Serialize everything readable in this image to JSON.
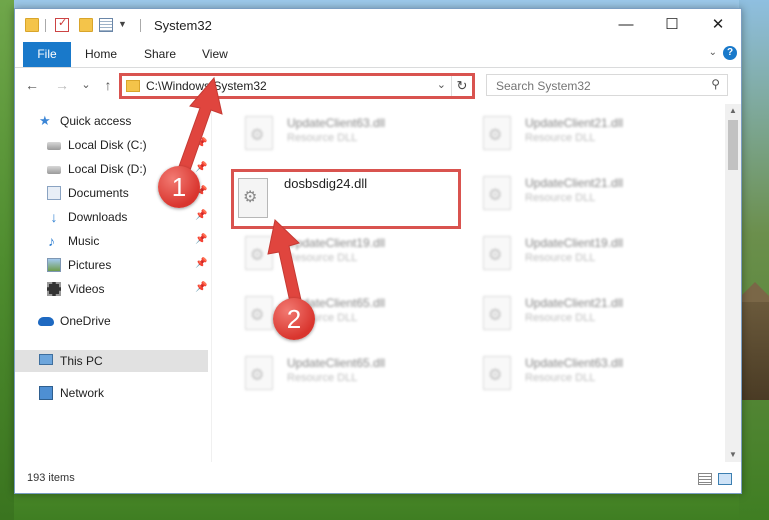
{
  "window": {
    "title": "System32"
  },
  "titlebar": {
    "minimize": "—",
    "maximize": "☐",
    "close": "✕"
  },
  "ribbon": {
    "tabs": [
      "File",
      "Home",
      "Share",
      "View"
    ],
    "help": "?"
  },
  "navigation": {
    "back": "←",
    "forward": "→",
    "recent": "⌄",
    "up": "↑",
    "address": "C:\\Windows\\System32",
    "refresh": "↻",
    "search_placeholder": "Search System32"
  },
  "sidebar": {
    "items": [
      {
        "label": "Quick access",
        "icon": "star-icon"
      },
      {
        "label": "Local Disk (C:)",
        "icon": "drive-icon"
      },
      {
        "label": "Local Disk (D:)",
        "icon": "drive-icon"
      },
      {
        "label": "Documents",
        "icon": "documents-icon"
      },
      {
        "label": "Downloads",
        "icon": "downloads-icon"
      },
      {
        "label": "Music",
        "icon": "music-icon"
      },
      {
        "label": "Pictures",
        "icon": "pictures-icon"
      },
      {
        "label": "Videos",
        "icon": "videos-icon"
      },
      {
        "label": "OneDrive",
        "icon": "cloud-icon"
      },
      {
        "label": "This PC",
        "icon": "computer-icon"
      },
      {
        "label": "Network",
        "icon": "network-icon"
      }
    ],
    "pin": "📌"
  },
  "files": [
    {
      "name": "UpdateClient63.dll",
      "type": "Resource DLL"
    },
    {
      "name": "UpdateClient21.dll",
      "type": "Resource DLL"
    },
    {
      "name": "dosbsdig24.dll",
      "type": ""
    },
    {
      "name": "UpdateClient21.dll",
      "type": "Resource DLL"
    },
    {
      "name": "UpdateClient19.dll",
      "type": "Resource DLL"
    },
    {
      "name": "UpdateClient19.dll",
      "type": "Resource DLL"
    },
    {
      "name": "UpdateClient65.dll",
      "type": "Resource DLL"
    },
    {
      "name": "UpdateClient21.dll",
      "type": "Resource DLL"
    },
    {
      "name": "UpdateClient65.dll",
      "type": "Resource DLL"
    },
    {
      "name": "UpdateClient63.dll",
      "type": "Resource DLL"
    }
  ],
  "status": {
    "item_count": "193 items"
  },
  "annotations": {
    "step1": "1",
    "step2": "2",
    "color": "#d9534f"
  }
}
